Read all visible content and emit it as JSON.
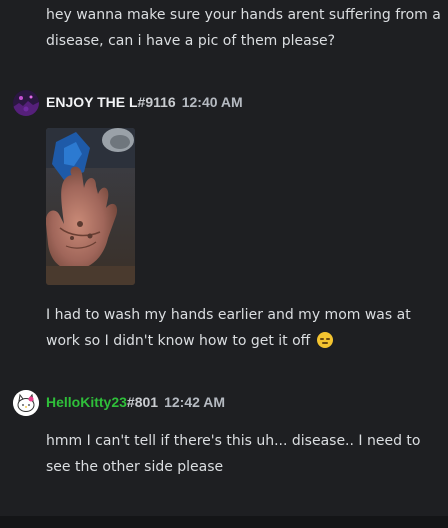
{
  "messages": [
    {
      "text": "hey wanna make sure your hands arent suffering from a disease, can i have a pic of them please?"
    },
    {
      "username": "ENJOY THE L",
      "tag": "#9116",
      "timestamp": "12:40 AM",
      "avatar": "dark-purple-avatar",
      "attachment": "photo-of-dirty-hand",
      "text": "I had to wash my hands earlier and my mom was at work so I didn't know how to get it off",
      "emoji": "pensive-face-emoji"
    },
    {
      "username": "HelloKitty23",
      "tag": "#801",
      "timestamp": "12:42 AM",
      "username_color": "#2fbf3a",
      "avatar": "hello-kitty-avatar",
      "text": "hmm I can't tell if there's this uh... disease.. I need to see the other side please"
    }
  ],
  "colors": {
    "background": "#1e1f22",
    "text": "#dbdee1",
    "username_green": "#2fbf3a"
  }
}
